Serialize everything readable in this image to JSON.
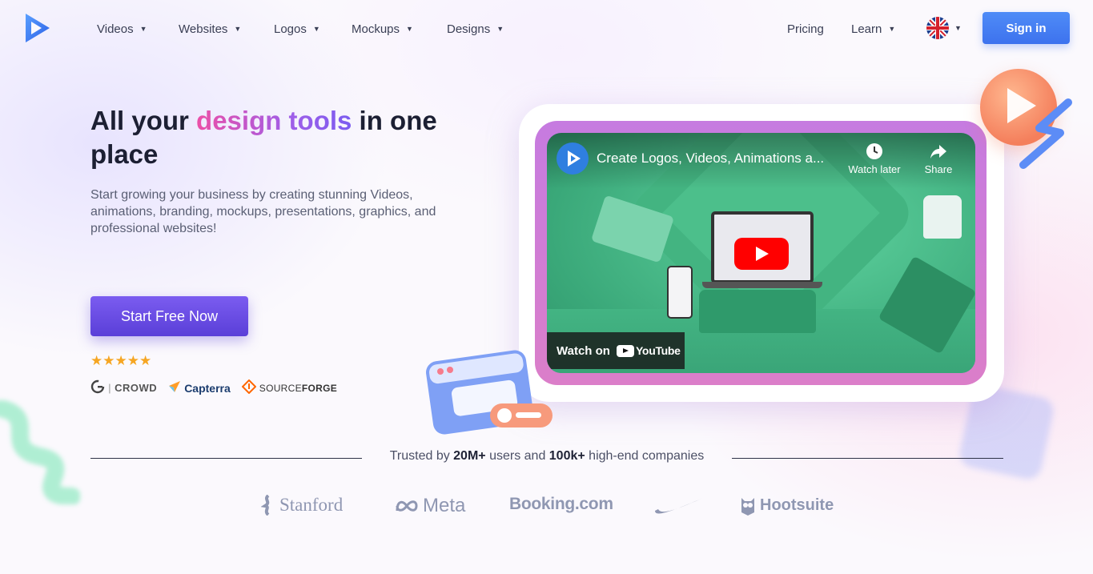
{
  "nav": {
    "items": [
      {
        "label": "Videos"
      },
      {
        "label": "Websites"
      },
      {
        "label": "Logos"
      },
      {
        "label": "Mockups"
      },
      {
        "label": "Designs"
      }
    ],
    "pricing": "Pricing",
    "learn": "Learn",
    "language_icon": "uk-flag-icon",
    "signin": "Sign in"
  },
  "hero": {
    "title_part1": "All your ",
    "title_highlight": "design tools",
    "title_part2": " in one place",
    "subtitle": "Start growing your business by creating stunning Videos, animations, branding, mockups, presentations, graphics, and professional websites!",
    "cta": "Start Free Now",
    "rating_stars": 5,
    "stars_text": "★★★★★",
    "review_sites": {
      "g2": "CROWD",
      "capterra": "Capterra",
      "sourceforge_a": "SOURCE",
      "sourceforge_b": "FORGE"
    }
  },
  "video": {
    "title": "Create Logos, Videos, Animations a...",
    "watch_later": "Watch later",
    "share": "Share",
    "watch_on": "Watch on",
    "youtube": "YouTube"
  },
  "trust": {
    "prefix": "Trusted by ",
    "users": "20M+",
    "middle": " users and ",
    "companies": "100k+",
    "suffix": " high-end companies",
    "logos": {
      "stanford": "Stanford",
      "meta": "Meta",
      "booking": "Booking.com",
      "hootsuite": "Hootsuite"
    }
  },
  "colors": {
    "accent_blue": "#3d72ee",
    "cta_purple": "#5a3fd8",
    "highlight_pink": "#ec4fa7",
    "star": "#f6a623"
  }
}
